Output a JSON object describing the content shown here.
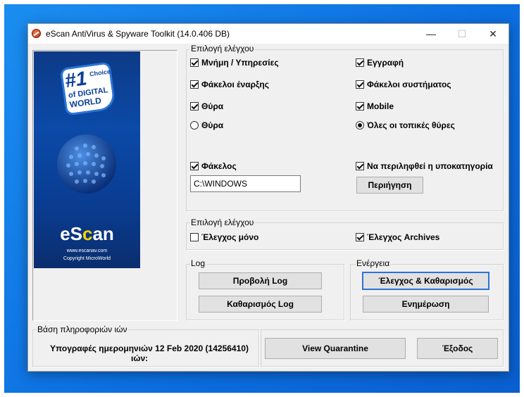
{
  "window": {
    "title": "eScan AntiVirus & Spyware Toolkit (14.0.406 DB)",
    "controls": {
      "minimize": "—",
      "maximize": "☐",
      "close": "✕"
    }
  },
  "banner": {
    "badge_number": "#1",
    "badge_choice": "Choice",
    "badge_line1": "of DIGITAL",
    "badge_line2": "WORLD",
    "brand_pre": "eS",
    "brand_accent": "c",
    "brand_post": "an",
    "url": "www.escanav.com",
    "copyright": "Copyright MicroWorld"
  },
  "scan_options": {
    "legend": "Επιλογή ελέγχου",
    "memory_services": {
      "label": "Μνήμη / Υπηρεσίες",
      "checked": true
    },
    "registry": {
      "label": "Εγγραφή",
      "checked": true
    },
    "startup_folders": {
      "label": "Φάκελοι έναρξης",
      "checked": true
    },
    "system_folders": {
      "label": "Φάκελοι συστήματος",
      "checked": true
    },
    "ports_check": {
      "label": "Θύρα",
      "checked": true
    },
    "mobile": {
      "label": "Mobile",
      "checked": true
    },
    "ports_radio": {
      "label": "Θύρα",
      "selected": false
    },
    "all_local_ports": {
      "label": "Όλες οι τοπικές θύρες",
      "selected": true
    },
    "folder": {
      "label": "Φάκελος",
      "checked": true
    },
    "include_subfolders": {
      "label": "Να περιληφθεί η υποκατηγορία",
      "checked": true
    },
    "folder_path": "C:\\WINDOWS",
    "browse_button": "Περιήγηση"
  },
  "scan_options2": {
    "legend": "Επιλογή ελέγχου",
    "scan_only": {
      "label": "Έλεγχος μόνο",
      "checked": false
    },
    "scan_archives": {
      "label": "Έλεγχος Archives",
      "checked": true
    }
  },
  "log": {
    "legend": "Log",
    "view_button": "Προβολή Log",
    "clear_button": "Καθαρισμός Log"
  },
  "action": {
    "legend": "Ενέργεια",
    "scan_clean_button": "Έλεγχος & Καθαρισμός",
    "update_button": "Ενημέρωση"
  },
  "virus_db": {
    "legend": "Βάση πληροφοριών ιών",
    "signatures_line1": "Υπογραφές ημερομηνιών 12 Feb 2020 (14256410)",
    "signatures_line2": "ιών:"
  },
  "bottom": {
    "view_quarantine_button": "View Quarantine",
    "exit_button": "Έξοδος"
  },
  "colors": {
    "desktop": "#0c6fe0",
    "window_bg": "#f0f0f0",
    "banner": "#0b4aa8",
    "brand_accent": "#ffd200",
    "default_button_border": "#2b73d6"
  }
}
